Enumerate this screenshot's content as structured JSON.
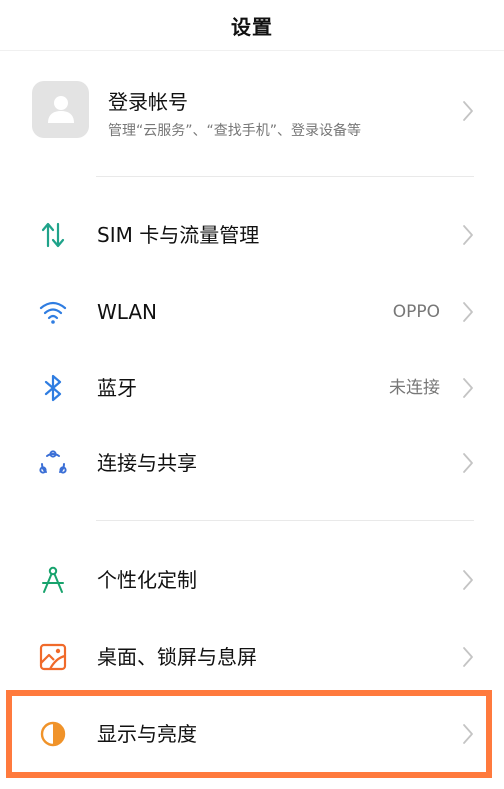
{
  "header": {
    "title": "设置"
  },
  "account": {
    "title": "登录帐号",
    "subtitle": "管理“云服务”、“查找手机”、登录设备等"
  },
  "items": [
    {
      "label": "SIM 卡与流量管理",
      "value": "",
      "icon": "sim-data-icon",
      "color": "#1fa38a"
    },
    {
      "label": "WLAN",
      "value": "OPPO",
      "icon": "wifi-icon",
      "color": "#2f7de1"
    },
    {
      "label": "蓝牙",
      "value": "未连接",
      "icon": "bluetooth-icon",
      "color": "#2f7de1"
    },
    {
      "label": "连接与共享",
      "value": "",
      "icon": "connection-sharing-icon",
      "color": "#3b6fd6"
    },
    {
      "label": "个性化定制",
      "value": "",
      "icon": "personalization-icon",
      "color": "#18a36d"
    },
    {
      "label": "桌面、锁屏与息屏",
      "value": "",
      "icon": "wallpaper-icon",
      "color": "#f06a2a"
    },
    {
      "label": "显示与亮度",
      "value": "",
      "icon": "display-brightness-icon",
      "color": "#f0932a"
    }
  ],
  "highlight_color": "#ff7a3d"
}
